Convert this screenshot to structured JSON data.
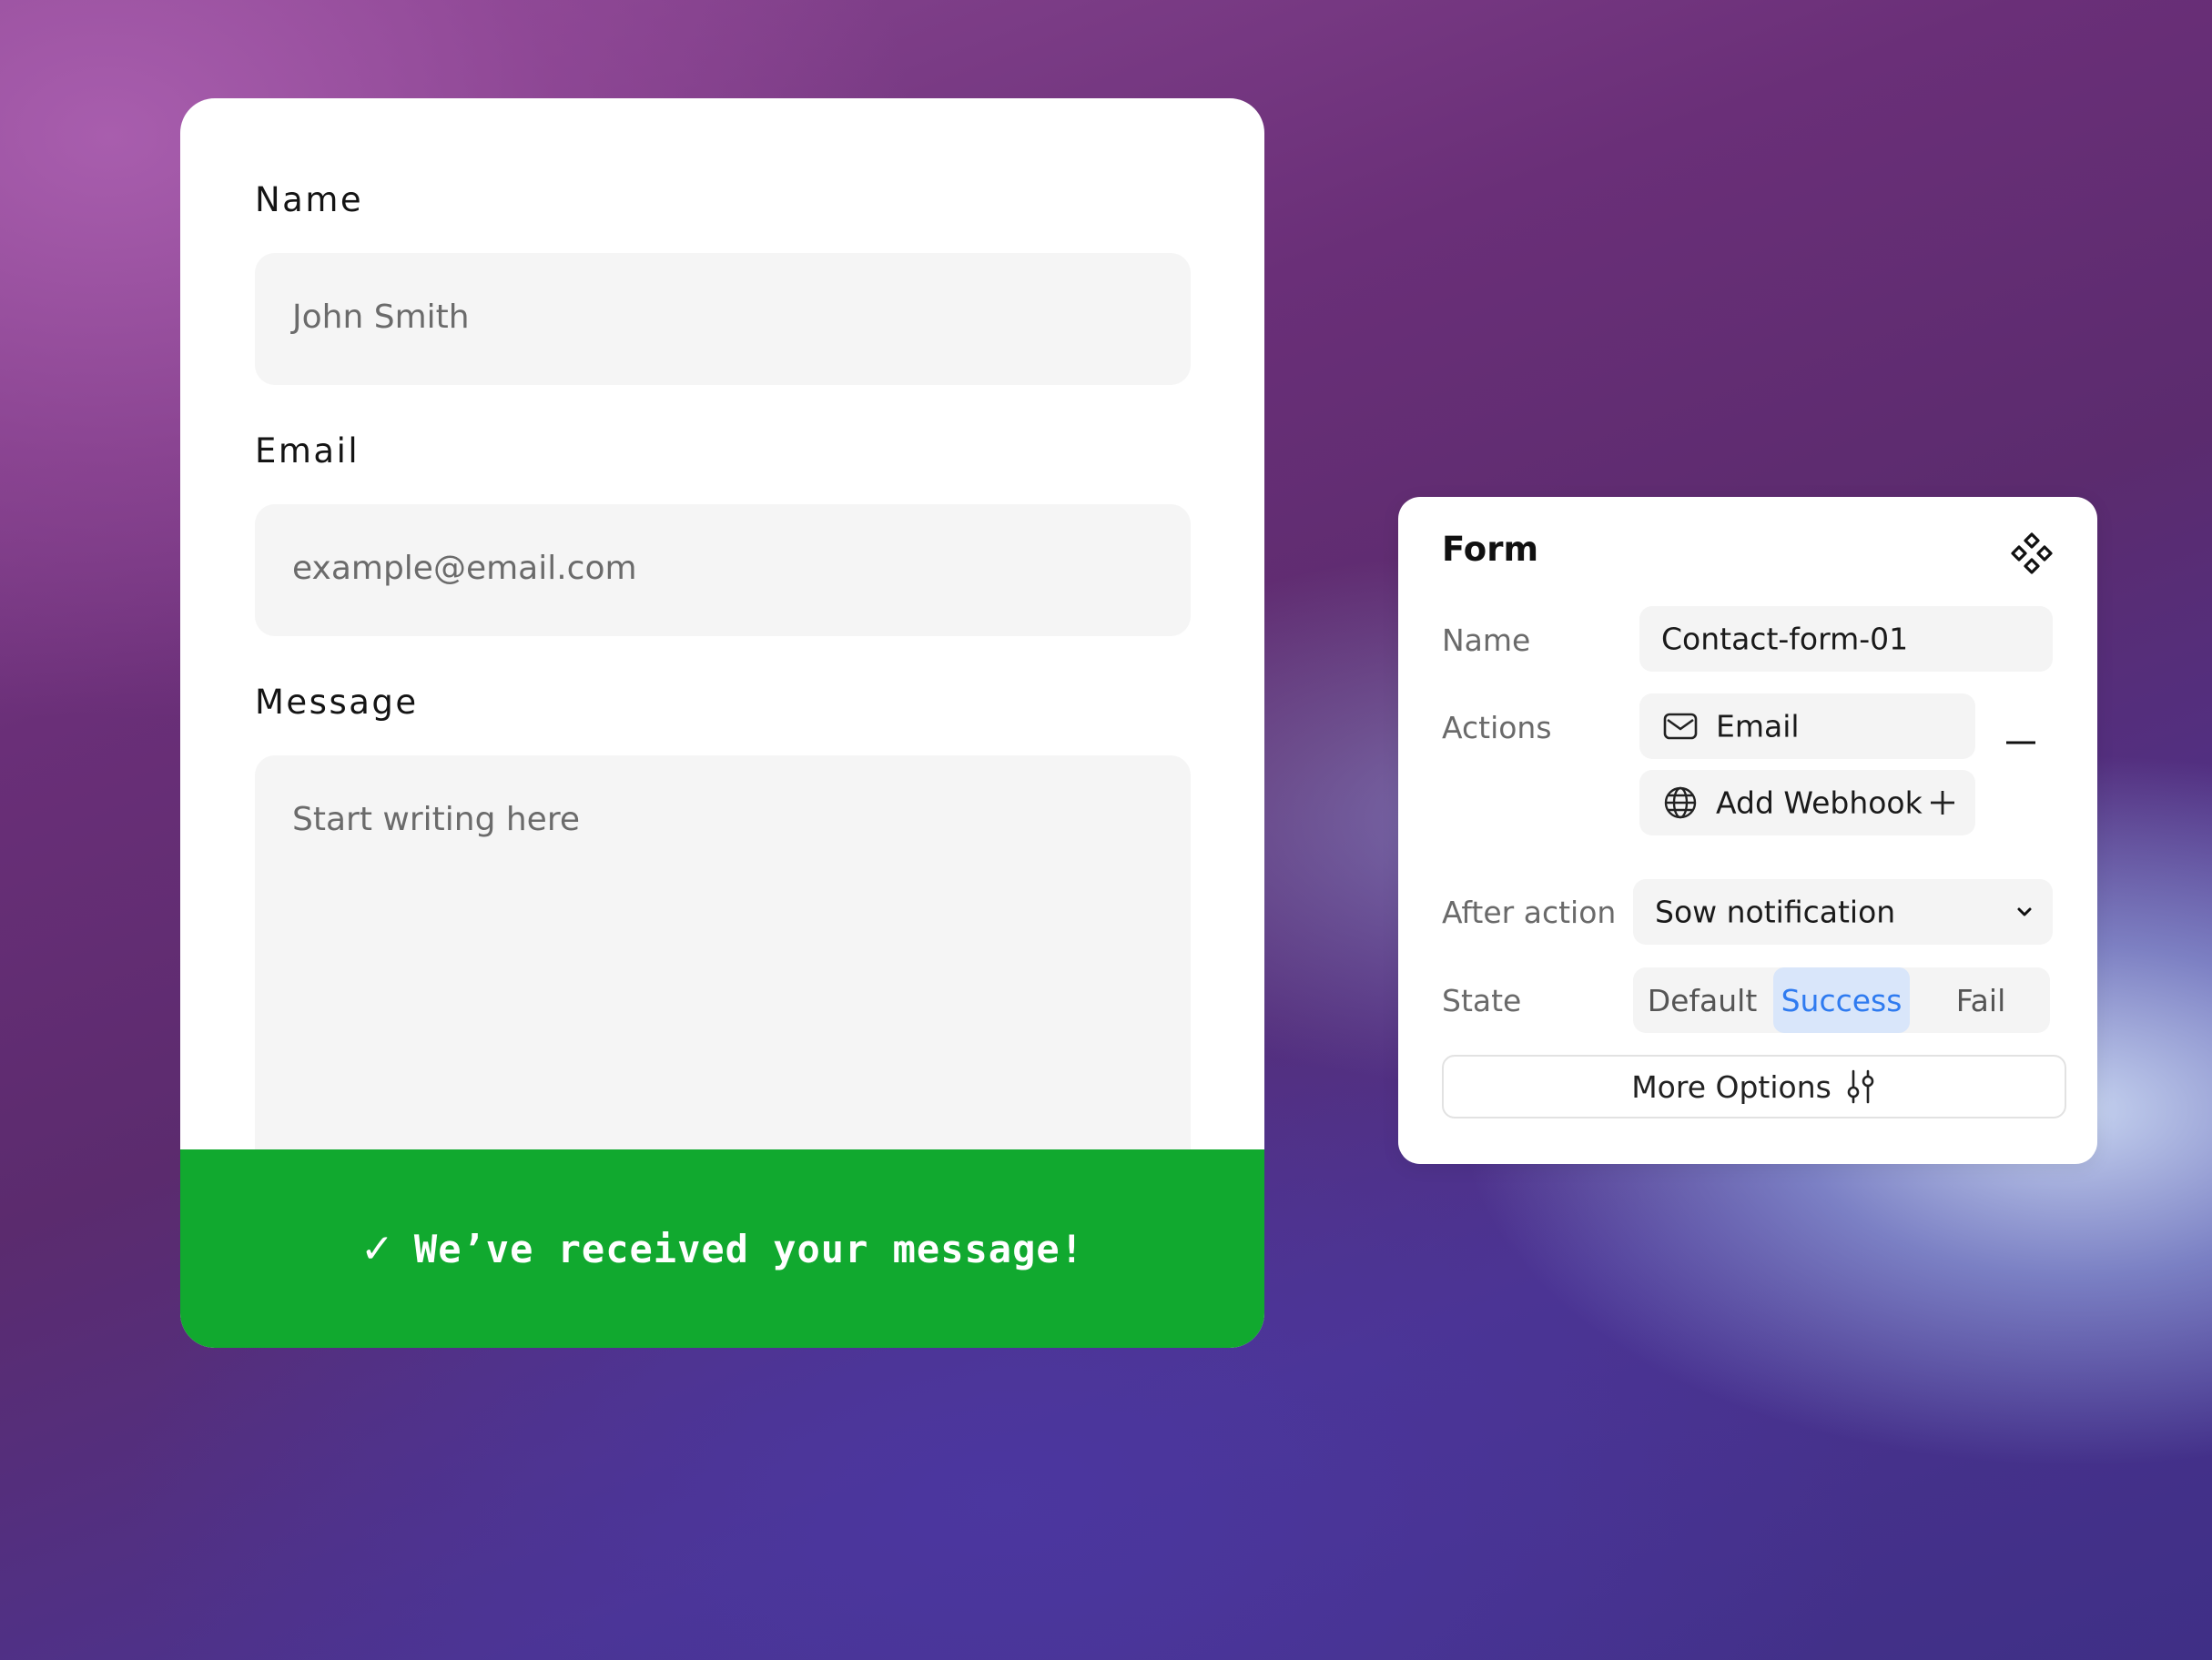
{
  "contact_form": {
    "name_label": "Name",
    "name_placeholder": "John Smith",
    "email_label": "Email",
    "email_placeholder": "example@email.com",
    "message_label": "Message",
    "message_placeholder": "Start writing here",
    "success_icon": "checkmark-icon",
    "success_message": "We’ve received your message!",
    "success_color": "#11a92f"
  },
  "panel": {
    "title": "Form",
    "title_icon": "components-icon",
    "name_label": "Name",
    "name_value": "Contact-form-01",
    "actions_label": "Actions",
    "actions": [
      {
        "icon": "mail-icon",
        "label": "Email",
        "control": "minus-icon"
      },
      {
        "icon": "globe-icon",
        "label": "Add Webhook",
        "control": "plus-icon"
      }
    ],
    "after_action_label": "After action",
    "after_action_value": "Sow notification",
    "state_label": "State",
    "states": [
      "Default",
      "Success",
      "Fail"
    ],
    "active_state": "Success",
    "accent_color": "#2f7bf0",
    "more_options_label": "More Options",
    "more_options_icon": "sliders-icon"
  }
}
